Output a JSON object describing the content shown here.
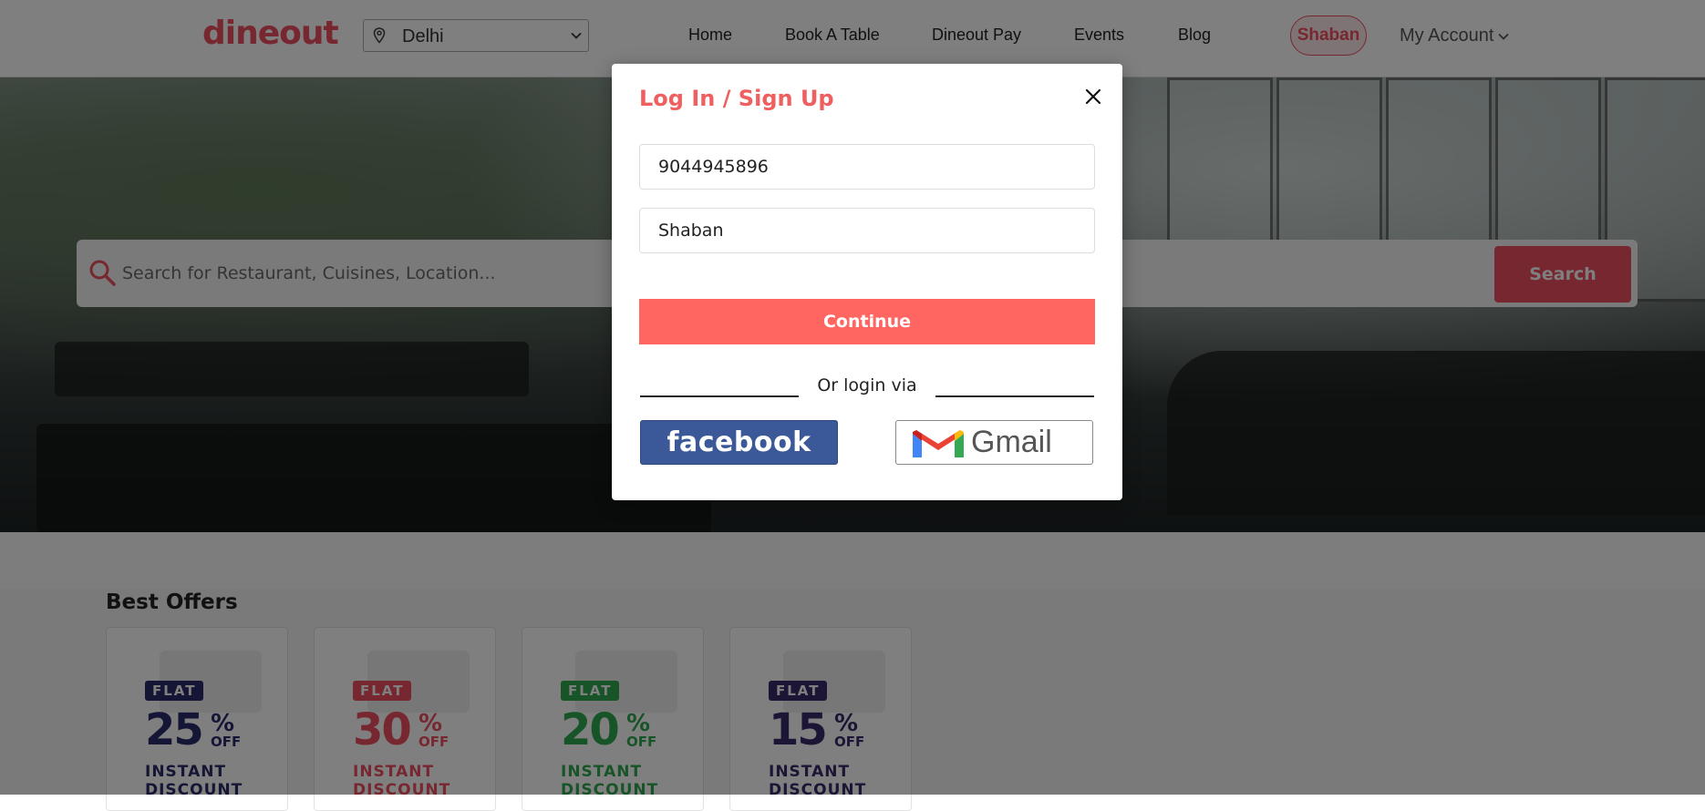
{
  "header": {
    "logo": "dineout",
    "city": "Delhi",
    "nav": [
      "Home",
      "Book A Table",
      "Dineout Pay",
      "Events",
      "Blog"
    ],
    "user": "Shaban",
    "account": "My Account"
  },
  "search": {
    "placeholder": "Search for Restaurant, Cuisines, Location...",
    "button": "Search"
  },
  "offers": {
    "title": "Best Offers",
    "cards": [
      {
        "flat": "FLAT",
        "num": "25",
        "pct": "%",
        "off": "OFF",
        "inst": "INSTANT DISCOUNT",
        "color": "#2b2b6b"
      },
      {
        "flat": "FLAT",
        "num": "30",
        "pct": "%",
        "off": "OFF",
        "inst": "INSTANT DISCOUNT",
        "color": "#ef4f5f"
      },
      {
        "flat": "FLAT",
        "num": "20",
        "pct": "%",
        "off": "OFF",
        "inst": "INSTANT DISCOUNT",
        "color": "#2fa84f"
      },
      {
        "flat": "FLAT",
        "num": "15",
        "pct": "%",
        "off": "OFF",
        "inst": "INSTANT DISCOUNT",
        "color": "#3a2a6a"
      }
    ]
  },
  "modal": {
    "title": "Log In / Sign Up",
    "phone_value": "9044945896",
    "name_value": "Shaban",
    "continue_label": "Continue",
    "or_text": "Or login via",
    "facebook_label": "facebook",
    "gmail_label": "Gmail"
  },
  "colors": {
    "brand": "#ef4f5f",
    "continue": "#ff6561",
    "facebook": "#3b5998"
  }
}
